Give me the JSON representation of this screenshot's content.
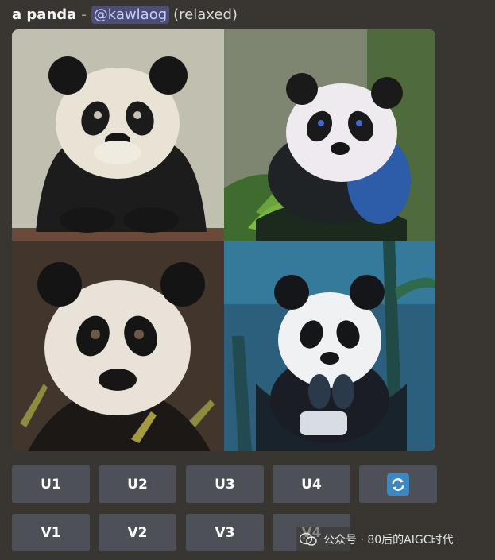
{
  "message": {
    "prompt": "a panda",
    "separator": "-",
    "mention": "@kawlaog",
    "mode": "(relaxed)"
  },
  "images": [
    {
      "name": "panda-image-1"
    },
    {
      "name": "panda-image-2"
    },
    {
      "name": "panda-image-3"
    },
    {
      "name": "panda-image-4"
    }
  ],
  "buttons": {
    "upscale": [
      "U1",
      "U2",
      "U3",
      "U4"
    ],
    "variation": [
      "V1",
      "V2",
      "V3",
      "V4"
    ],
    "reroll_icon": "refresh-icon"
  },
  "watermark": {
    "text": "公众号 · 80后的AIGC时代"
  },
  "colors": {
    "background": "#393631",
    "button": "#4e5058",
    "mention_bg": "#4b4f78",
    "mention_text": "#c9cdfb",
    "refresh_blue": "#3b88c3"
  }
}
